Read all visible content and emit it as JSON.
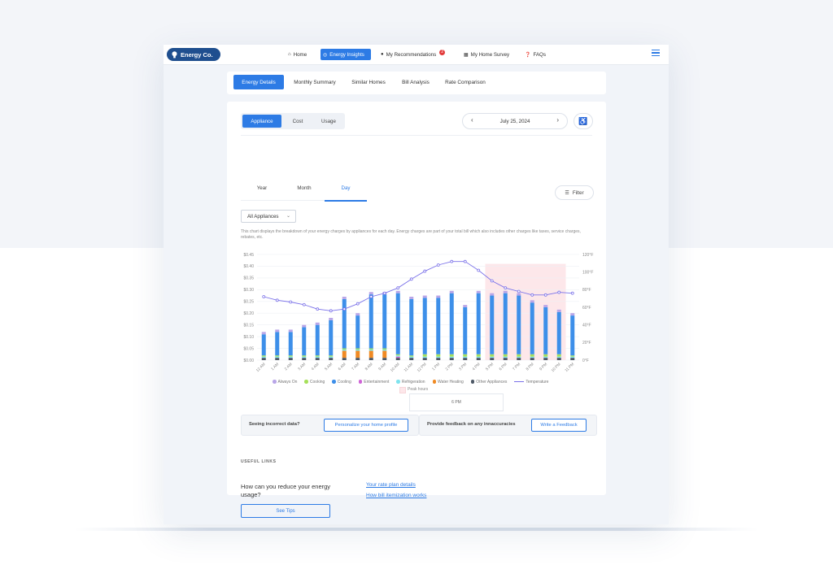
{
  "brand": {
    "name": "Energy Co."
  },
  "nav": {
    "items": [
      {
        "label": "Home",
        "icon": "home-icon"
      },
      {
        "label": "Energy Insights",
        "icon": "insights-icon",
        "active": true
      },
      {
        "label": "My Recommendations",
        "icon": "chat-icon",
        "badge": "2"
      },
      {
        "label": "My Home Survey",
        "icon": "calendar-icon"
      },
      {
        "label": "FAQs",
        "icon": "help-icon"
      }
    ]
  },
  "section_tabs": [
    "Energy Details",
    "Monthly Summary",
    "Similar Homes",
    "Bill Analysis",
    "Rate Comparison"
  ],
  "view_toggle": [
    "Appliance",
    "Cost",
    "Usage"
  ],
  "date": {
    "label": "July 25, 2024"
  },
  "period_tabs": [
    "Year",
    "Month",
    "Day"
  ],
  "filter": {
    "label": "Filter"
  },
  "appliance_select": {
    "value": "All Appliances"
  },
  "description": "This chart displays the breakdown of your energy charges by appliances for each day. Energy charges are part of your total bill which also includes other charges like taxes, service charges, rebates, etc.",
  "colors": {
    "accent": "#2d7be5",
    "always_on": "#b9a6e8",
    "cooking": "#a6e05a",
    "cooling": "#3d8fe9",
    "entertainment": "#cf63d6",
    "refrigeration": "#7fe3ee",
    "water_heating": "#f08a24",
    "other": "#4d5866",
    "temperature": "#7b72e9",
    "peak": "#fde7ea"
  },
  "chart_data": {
    "type": "bar",
    "stacked": true,
    "categories": [
      "12 AM",
      "1 AM",
      "2 AM",
      "3 AM",
      "4 AM",
      "5 AM",
      "6 AM",
      "7 AM",
      "8 AM",
      "9 AM",
      "10 AM",
      "11 AM",
      "12 PM",
      "1 PM",
      "2 PM",
      "3 PM",
      "4 PM",
      "5 PM",
      "6 PM",
      "7 PM",
      "8 PM",
      "9 PM",
      "10 PM",
      "11 PM"
    ],
    "y_ticks": [
      "$0.00",
      "$0.05",
      "$0.10",
      "$0.15",
      "$0.20",
      "$0.25",
      "$0.30",
      "$0.35",
      "$0.40",
      "$0.45"
    ],
    "ylim": [
      0,
      0.45
    ],
    "y2_ticks": [
      "0°F",
      "20°F",
      "40°F",
      "60°F",
      "80°F",
      "100°F",
      "120°F"
    ],
    "y2lim": [
      0,
      120
    ],
    "series": [
      {
        "name": "Other Appliances",
        "values": [
          0.01,
          0.01,
          0.01,
          0.01,
          0.01,
          0.01,
          0.01,
          0.01,
          0.01,
          0.01,
          0.01,
          0.01,
          0.01,
          0.01,
          0.01,
          0.01,
          0.01,
          0.01,
          0.01,
          0.01,
          0.01,
          0.01,
          0.01,
          0.01
        ]
      },
      {
        "name": "Water Heating",
        "values": [
          0,
          0,
          0,
          0,
          0,
          0,
          0.03,
          0.03,
          0.03,
          0.03,
          0,
          0,
          0,
          0,
          0,
          0,
          0,
          0,
          0,
          0,
          0,
          0,
          0,
          0
        ]
      },
      {
        "name": "Entertainment",
        "values": [
          0,
          0,
          0,
          0,
          0,
          0,
          0,
          0,
          0,
          0,
          0.005,
          0,
          0,
          0,
          0,
          0,
          0,
          0,
          0,
          0,
          0,
          0,
          0,
          0
        ]
      },
      {
        "name": "Refrigeration",
        "values": [
          0.005,
          0.005,
          0.005,
          0.005,
          0.005,
          0.005,
          0.005,
          0.005,
          0.005,
          0.005,
          0.005,
          0.005,
          0.005,
          0.005,
          0.005,
          0.005,
          0.005,
          0.005,
          0.005,
          0.005,
          0.005,
          0.005,
          0.005,
          0.005
        ]
      },
      {
        "name": "Cooking",
        "values": [
          0.005,
          0.005,
          0.005,
          0.005,
          0.005,
          0.005,
          0.005,
          0.005,
          0.005,
          0.005,
          0.005,
          0.005,
          0.01,
          0.01,
          0.01,
          0.01,
          0.01,
          0.01,
          0.01,
          0.01,
          0.01,
          0.01,
          0.01,
          0.005
        ]
      },
      {
        "name": "Cooling",
        "values": [
          0.09,
          0.1,
          0.1,
          0.12,
          0.13,
          0.15,
          0.21,
          0.14,
          0.23,
          0.23,
          0.26,
          0.24,
          0.24,
          0.24,
          0.26,
          0.2,
          0.26,
          0.25,
          0.26,
          0.25,
          0.22,
          0.2,
          0.18,
          0.17
        ]
      },
      {
        "name": "Always On",
        "values": [
          0.01,
          0.01,
          0.01,
          0.01,
          0.01,
          0.01,
          0.01,
          0.01,
          0.01,
          0.01,
          0.01,
          0.01,
          0.01,
          0.01,
          0.01,
          0.01,
          0.01,
          0.01,
          0.01,
          0.01,
          0.01,
          0.01,
          0.01,
          0.01
        ]
      }
    ],
    "temperature": {
      "name": "Temperature",
      "values": [
        72,
        68,
        66,
        63,
        58,
        56,
        58,
        64,
        72,
        76,
        82,
        92,
        101,
        108,
        112,
        112,
        102,
        90,
        82,
        78,
        74,
        74,
        77,
        76
      ]
    },
    "peak_hours": {
      "label": "Peak hours",
      "from": "5 PM",
      "to": "10 PM"
    },
    "tooltip": "6 PM",
    "legend": [
      "Always On",
      "Cooking",
      "Cooling",
      "Entertainment",
      "Refrigeration",
      "Water Heating",
      "Other Appliances",
      "Temperature"
    ]
  },
  "feedback": {
    "left_text": "Seeing incorrect data?",
    "left_button": "Personalize your home profile",
    "right_text": "Provide feedback on any innaccuracies",
    "right_button": "Write a Feedback"
  },
  "useful_links": {
    "heading": "USEFUL LINKS",
    "question": "How can you reduce your energy usage?",
    "tips_button": "See Tips",
    "links": [
      "Your rate plan details",
      "How bill itemization works"
    ]
  }
}
